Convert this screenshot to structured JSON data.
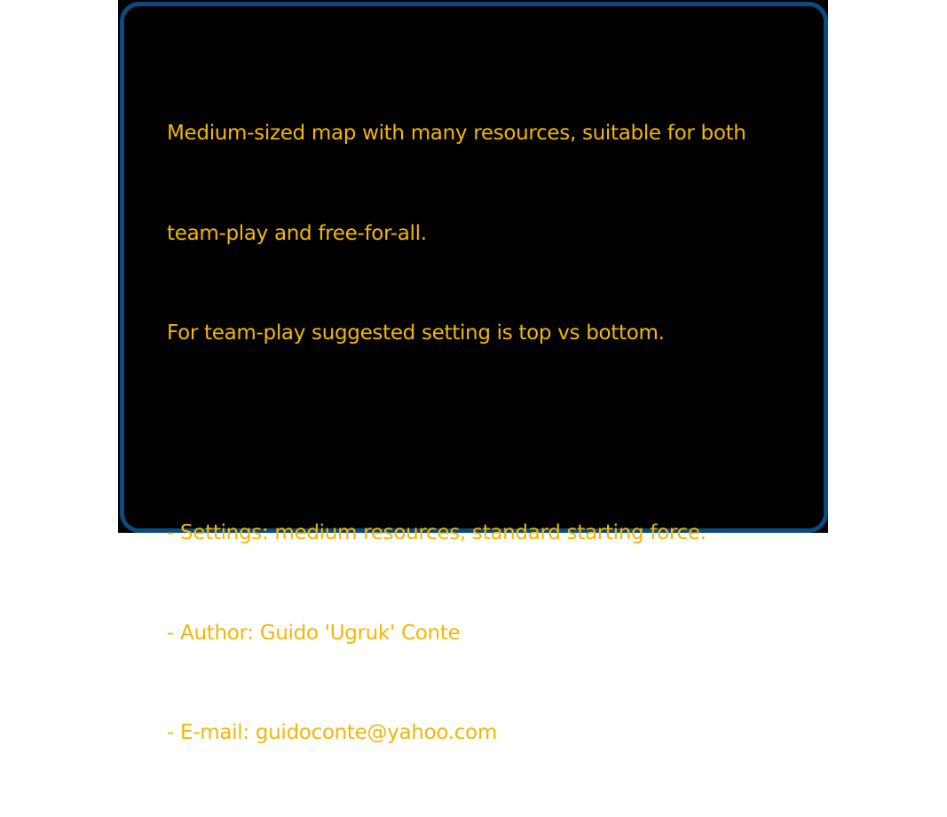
{
  "panel": {
    "border_color": "#0b4a80",
    "text_color": "#f2b705"
  },
  "description": {
    "lines": [
      "Medium-sized map with many resources, suitable for both",
      "team-play and free-for-all.",
      "For team-play suggested setting is top vs bottom.",
      "",
      "- Settings: medium resources, standard starting force.",
      "- Author: Guido 'Ugruk' Conte",
      "- E-mail: guidoconte@yahoo.com"
    ]
  }
}
